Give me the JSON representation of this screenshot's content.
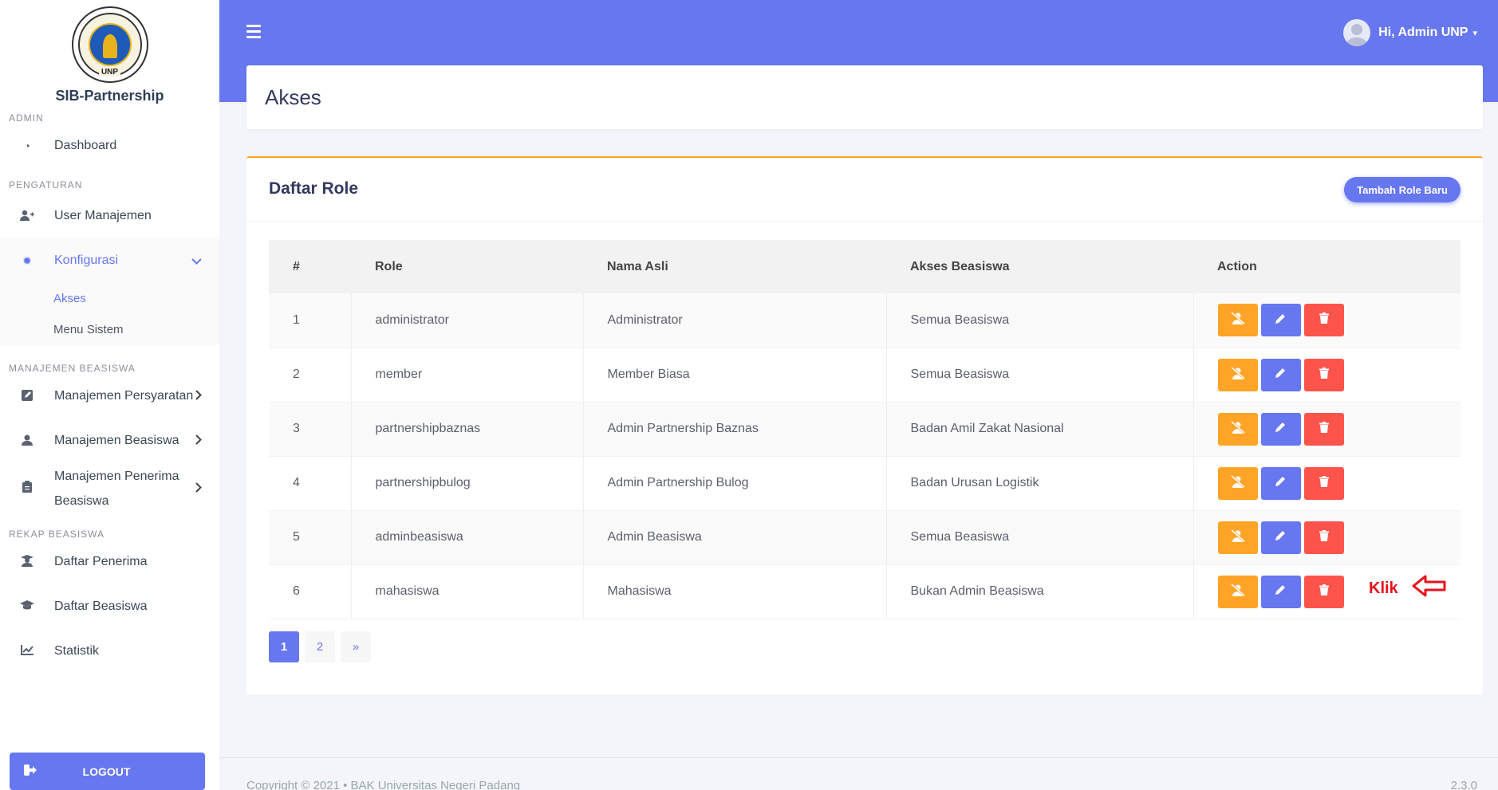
{
  "brand": {
    "logo_text": "UNP",
    "name": "SIB-Partnership"
  },
  "sidebar": {
    "sections": {
      "admin": "ADMIN",
      "pengaturan": "PENGATURAN",
      "manajemen_beasiswa": "MANAJEMEN BEASISWA",
      "rekap_beasiswa": "REKAP BEASISWA"
    },
    "items": {
      "dashboard": "Dashboard",
      "user_manajemen": "User Manajemen",
      "konfigurasi": "Konfigurasi",
      "akses": "Akses",
      "menu_sistem": "Menu Sistem",
      "manajemen_persyaratan": "Manajemen Persyaratan",
      "manajemen_beasiswa": "Manajemen Beasiswa",
      "manajemen_penerima_1": "Manajemen Penerima",
      "manajemen_penerima_2": "Beasiswa",
      "daftar_penerima": "Daftar Penerima",
      "daftar_beasiswa": "Daftar Beasiswa",
      "statistik": "Statistik"
    },
    "logout": "LOGOUT"
  },
  "header": {
    "user_label": "Hi, Admin UNP"
  },
  "page": {
    "title": "Akses"
  },
  "card": {
    "title": "Daftar Role",
    "add_button": "Tambah Role Baru",
    "columns": [
      "#",
      "Role",
      "Nama Asli",
      "Akses Beasiswa",
      "Action"
    ],
    "rows": [
      [
        "1",
        "administrator",
        "Administrator",
        "Semua Beasiswa"
      ],
      [
        "2",
        "member",
        "Member Biasa",
        "Semua Beasiswa"
      ],
      [
        "3",
        "partnershipbaznas",
        "Admin Partnership Baznas",
        "Badan Amil Zakat Nasional"
      ],
      [
        "4",
        "partnershipbulog",
        "Admin Partnership Bulog",
        "Badan Urusan Logistik"
      ],
      [
        "5",
        "adminbeasiswa",
        "Admin Beasiswa",
        "Semua Beasiswa"
      ],
      [
        "6",
        "mahasiswa",
        "Mahasiswa",
        "Bukan Admin Beasiswa"
      ]
    ],
    "annotation": "Klik",
    "pagination": [
      "1",
      "2",
      "»"
    ]
  },
  "footer": {
    "copyright": "Copyright © 2021 • BAK Universitas Negeri Padang",
    "version": "2.3.0"
  },
  "colors": {
    "primary": "#6777ef",
    "warning": "#ffa426",
    "danger": "#fc544b",
    "annotation": "#e6121b"
  }
}
